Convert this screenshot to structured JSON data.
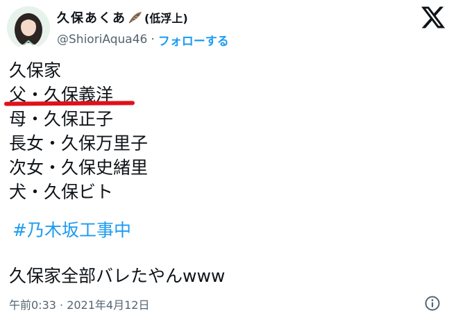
{
  "author": {
    "display_name": "久保あくあ",
    "display_name_suffix": "(低浮上)",
    "handle": "@ShioriAqua46",
    "separator": "·",
    "follow_label": "フォローする"
  },
  "icons": {
    "avatar": "profile-photo",
    "name_emoji": "feather-icon",
    "brand": "x-logo-icon",
    "info": "info-icon"
  },
  "tweet": {
    "lines": [
      "久保家",
      "父・久保義洋",
      "母・久保正子",
      "長女・久保万里子",
      "次女・久保史緒里",
      "犬・久保ビト"
    ],
    "hashtag": "#乃木坂工事中",
    "final_line": "久保家全部バレたやんwww",
    "timestamp": "午前0:33 · 2021年4月12日"
  },
  "colors": {
    "link_blue": "#1d9bf0",
    "secondary_text": "#536471",
    "underline_red": "#e0101a"
  }
}
